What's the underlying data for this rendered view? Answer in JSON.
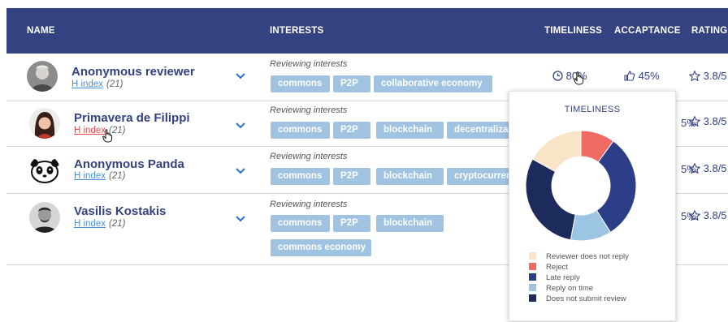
{
  "header": {
    "name": "NAME",
    "interests": "INTERESTS",
    "timeliness": "TIMELINESS",
    "acceptance": "ACCAPTANCE",
    "rating": "RATING"
  },
  "colors": {
    "header_bg": "#344282",
    "tag_bg": "#9fc3e1",
    "name_text": "#344282",
    "link": "#4a90d9",
    "link_active": "#e24b4b"
  },
  "rows": [
    {
      "name": "Anonymous reviewer",
      "h_index_label": "H index",
      "h_index_value": "(21)",
      "reviewing_label": "Reviewing interests",
      "tags": [
        "commons",
        "P2P",
        "collaborative economy"
      ],
      "timeliness": "80%",
      "acceptance": "45%",
      "rating": "3.8/5"
    },
    {
      "name": "Primavera de Filippi",
      "h_index_label": "H index",
      "h_index_value": "(21)",
      "reviewing_label": "Reviewing interests",
      "tags": [
        "commons",
        "P2P",
        "blockchain",
        "decentralization"
      ],
      "acceptance": "5%",
      "rating": "3.8/5"
    },
    {
      "name": "Anonymous Panda",
      "h_index_label": "H index",
      "h_index_value": "(21)",
      "reviewing_label": "Reviewing interests",
      "tags": [
        "commons",
        "P2P",
        "blockchain",
        "cryptocurrency"
      ],
      "acceptance": "5%",
      "rating": "3.8/5"
    },
    {
      "name": "Vasilis Kostakis",
      "h_index_label": "H index",
      "h_index_value": "(21)",
      "reviewing_label": "Reviewing interests",
      "tags": [
        "commons",
        "P2P",
        "blockchain",
        "commons economy"
      ],
      "acceptance": "5%",
      "rating": "3.8/5"
    }
  ],
  "popup": {
    "title": "TIMELINESS"
  },
  "chart_data": {
    "type": "pie",
    "variant": "donut",
    "title": "TIMELINESS",
    "legend_position": "bottom",
    "series": [
      {
        "name": "Reviewer does not reply",
        "value": 17,
        "color": "#f9e4c8"
      },
      {
        "name": "Reject",
        "value": 10,
        "color": "#ee6a63"
      },
      {
        "name": "Late reply",
        "value": 31,
        "color": "#2c3e87"
      },
      {
        "name": "Reply on time",
        "value": 12,
        "color": "#9cc4e3"
      },
      {
        "name": "Does not submit review",
        "value": 30,
        "color": "#1c2a5c"
      }
    ]
  }
}
